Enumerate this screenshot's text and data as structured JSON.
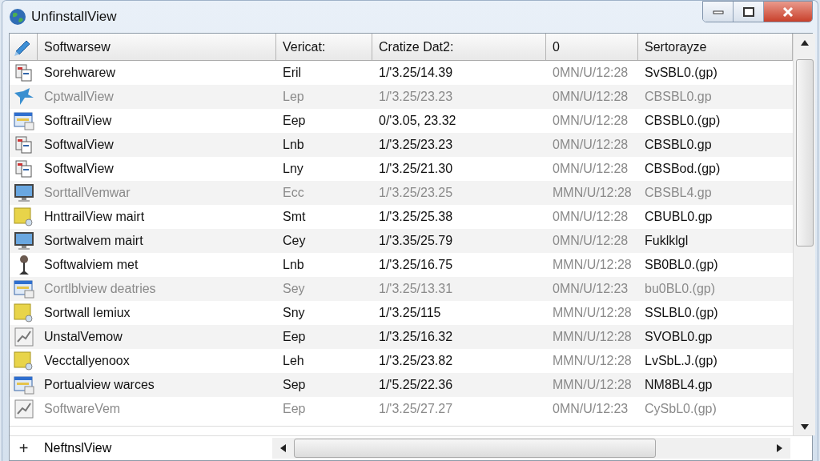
{
  "window": {
    "title": "UnfinstallView"
  },
  "columns": [
    "Softwarsew",
    "Vericat:",
    "Cratize Dat2:",
    "0",
    "Sertorayze"
  ],
  "rows": [
    {
      "kind": "files",
      "name": "Sorehwarew",
      "version": "Eril",
      "date": "1/'3.25/14.39",
      "column_4": "0MN/U/12:28",
      "column_5": "SvSBL0.(gp)",
      "dimmed": false
    },
    {
      "kind": "bird",
      "name": "CptwallView",
      "version": "Lep",
      "date": "1/'3.25/23.23",
      "column_4": "0MN/U/12:28",
      "column_5": "CBSBL0.gp",
      "dimmed": true
    },
    {
      "kind": "window",
      "name": "SoftrailView",
      "version": "Eep",
      "date": "0/'3.05, 23.32",
      "column_4": "0MN/U/12:28",
      "column_5": "CBSBL0.(gp)",
      "dimmed": false
    },
    {
      "kind": "files",
      "name": "SoftwalView",
      "version": "Lnb",
      "date": "1/'3.25/23.23",
      "column_4": "0MN/U/12:28",
      "column_5": "CBSBL0.gp",
      "dimmed": false
    },
    {
      "kind": "files",
      "name": "SoftwalView",
      "version": "Lny",
      "date": "1/'3.25/21.30",
      "column_4": "0MN/U/12:28",
      "column_5": "CBSBod.(gp)",
      "dimmed": false
    },
    {
      "kind": "monitor",
      "name": "SorttallVemwar",
      "version": "Ecc",
      "date": "1/'3.25/23.25",
      "column_4": "MMN/U/12:28",
      "column_5": "CBSBL4.gp",
      "dimmed": true
    },
    {
      "kind": "note",
      "name": "HnttrailView mairt",
      "version": "Smt",
      "date": "1/'3.25/25.38",
      "column_4": "0MN/U/12:28",
      "column_5": "CBUBL0.gp",
      "dimmed": false
    },
    {
      "kind": "monitor",
      "name": "Sortwalvem mairt",
      "version": "Cey",
      "date": "1/'3.35/25.79",
      "column_4": "0MN/U/12:28",
      "column_5": "Fuklklgl",
      "dimmed": false
    },
    {
      "kind": "pin",
      "name": "Softwalviem met",
      "version": "Lnb",
      "date": "1/'3.25/16.75",
      "column_4": "MMN/U/12:28",
      "column_5": "SB0BL0.(gp)",
      "dimmed": false
    },
    {
      "kind": "window",
      "name": "Cortlblview deatries",
      "version": "Sey",
      "date": "1/'3.25/13.31",
      "column_4": "0MN/U/12:23",
      "column_5": "bu0BL0.(gp)",
      "dimmed": true
    },
    {
      "kind": "note",
      "name": "Sortwall lemiux",
      "version": "Sny",
      "date": "1/'3.25/115",
      "column_4": "MMN/U/12:28",
      "column_5": "SSLBL0.(gp)",
      "dimmed": false
    },
    {
      "kind": "chart",
      "name": "UnstalVemow",
      "version": "Eep",
      "date": "1/'3.25/16.32",
      "column_4": "MMN/U/12:28",
      "column_5": "SVOBL0.gp",
      "dimmed": false
    },
    {
      "kind": "note",
      "name": "Vecctallyenoox",
      "version": "Leh",
      "date": "1/'3.25/23.82",
      "column_4": "MMN/U/12:28",
      "column_5": "LvSbL.J.(gp)",
      "dimmed": false
    },
    {
      "kind": "window",
      "name": "Portualview warces",
      "version": "Sep",
      "date": "1/'5.25/22.36",
      "column_4": "MMN/U/12:28",
      "column_5": "NM8BL4.gp",
      "dimmed": false
    },
    {
      "kind": "chart",
      "name": "SoftwareVem",
      "version": "Eep",
      "date": "1/'3.25/27.27",
      "column_4": "0MN/U/12:23",
      "column_5": "CySbL0.(gp)",
      "dimmed": true
    }
  ],
  "footer_row": {
    "symbol": "+",
    "name": "NeftnslView"
  }
}
